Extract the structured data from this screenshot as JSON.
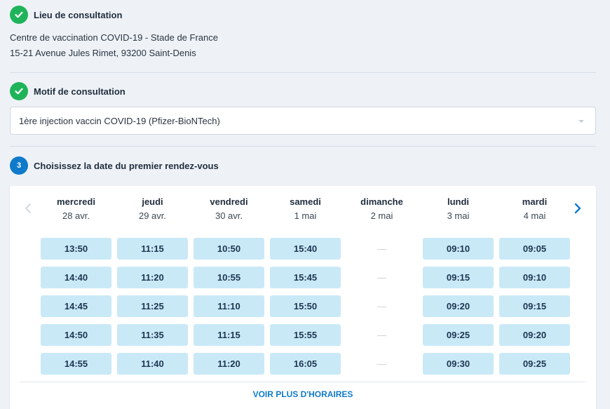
{
  "step1": {
    "title": "Lieu de consultation",
    "address_line1": "Centre de vaccination COVID-19 - Stade de France",
    "address_line2": "15-21 Avenue Jules Rimet, 93200 Saint-Denis"
  },
  "step2": {
    "title": "Motif de consultation",
    "selected": "1ère injection vaccin COVID-19 (Pfizer-BioNTech)"
  },
  "step3": {
    "badge": "3",
    "title": "Choisissez la date du premier rendez-vous"
  },
  "calendar": {
    "days": [
      {
        "name": "mercredi",
        "date": "28 avr.",
        "slots": [
          "13:50",
          "14:40",
          "14:45",
          "14:50",
          "14:55"
        ]
      },
      {
        "name": "jeudi",
        "date": "29 avr.",
        "slots": [
          "11:15",
          "11:20",
          "11:25",
          "11:35",
          "11:40"
        ]
      },
      {
        "name": "vendredi",
        "date": "30 avr.",
        "slots": [
          "10:50",
          "10:55",
          "11:10",
          "11:15",
          "11:20"
        ]
      },
      {
        "name": "samedi",
        "date": "1 mai",
        "slots": [
          "15:40",
          "15:45",
          "15:50",
          "15:55",
          "16:05"
        ]
      },
      {
        "name": "dimanche",
        "date": "2 mai",
        "slots": [
          "—",
          "—",
          "—",
          "—",
          "—"
        ]
      },
      {
        "name": "lundi",
        "date": "3 mai",
        "slots": [
          "09:10",
          "09:15",
          "09:20",
          "09:25",
          "09:30"
        ]
      },
      {
        "name": "mardi",
        "date": "4 mai",
        "slots": [
          "09:05",
          "09:10",
          "09:15",
          "09:20",
          "09:25"
        ]
      }
    ],
    "more_label": "VOIR PLUS D'HORAIRES"
  },
  "colors": {
    "done_green": "#1fb45a",
    "accent_blue": "#107aca",
    "slot_bg": "#c9e9f7"
  },
  "icons": {
    "step_done": "check-icon",
    "prev": "chevron-left-icon",
    "next": "chevron-right-icon",
    "select": "caret-down-icon"
  }
}
